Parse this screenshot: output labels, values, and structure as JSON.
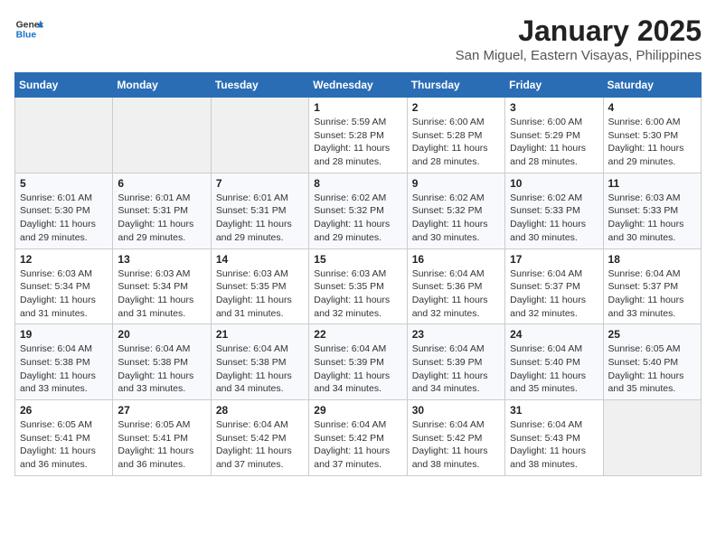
{
  "logo": {
    "line1": "General",
    "line2": "Blue"
  },
  "title": "January 2025",
  "subtitle": "San Miguel, Eastern Visayas, Philippines",
  "weekdays": [
    "Sunday",
    "Monday",
    "Tuesday",
    "Wednesday",
    "Thursday",
    "Friday",
    "Saturday"
  ],
  "weeks": [
    [
      {
        "day": "",
        "content": ""
      },
      {
        "day": "",
        "content": ""
      },
      {
        "day": "",
        "content": ""
      },
      {
        "day": "1",
        "content": "Sunrise: 5:59 AM\nSunset: 5:28 PM\nDaylight: 11 hours and 28 minutes."
      },
      {
        "day": "2",
        "content": "Sunrise: 6:00 AM\nSunset: 5:28 PM\nDaylight: 11 hours and 28 minutes."
      },
      {
        "day": "3",
        "content": "Sunrise: 6:00 AM\nSunset: 5:29 PM\nDaylight: 11 hours and 28 minutes."
      },
      {
        "day": "4",
        "content": "Sunrise: 6:00 AM\nSunset: 5:30 PM\nDaylight: 11 hours and 29 minutes."
      }
    ],
    [
      {
        "day": "5",
        "content": "Sunrise: 6:01 AM\nSunset: 5:30 PM\nDaylight: 11 hours and 29 minutes."
      },
      {
        "day": "6",
        "content": "Sunrise: 6:01 AM\nSunset: 5:31 PM\nDaylight: 11 hours and 29 minutes."
      },
      {
        "day": "7",
        "content": "Sunrise: 6:01 AM\nSunset: 5:31 PM\nDaylight: 11 hours and 29 minutes."
      },
      {
        "day": "8",
        "content": "Sunrise: 6:02 AM\nSunset: 5:32 PM\nDaylight: 11 hours and 29 minutes."
      },
      {
        "day": "9",
        "content": "Sunrise: 6:02 AM\nSunset: 5:32 PM\nDaylight: 11 hours and 30 minutes."
      },
      {
        "day": "10",
        "content": "Sunrise: 6:02 AM\nSunset: 5:33 PM\nDaylight: 11 hours and 30 minutes."
      },
      {
        "day": "11",
        "content": "Sunrise: 6:03 AM\nSunset: 5:33 PM\nDaylight: 11 hours and 30 minutes."
      }
    ],
    [
      {
        "day": "12",
        "content": "Sunrise: 6:03 AM\nSunset: 5:34 PM\nDaylight: 11 hours and 31 minutes."
      },
      {
        "day": "13",
        "content": "Sunrise: 6:03 AM\nSunset: 5:34 PM\nDaylight: 11 hours and 31 minutes."
      },
      {
        "day": "14",
        "content": "Sunrise: 6:03 AM\nSunset: 5:35 PM\nDaylight: 11 hours and 31 minutes."
      },
      {
        "day": "15",
        "content": "Sunrise: 6:03 AM\nSunset: 5:35 PM\nDaylight: 11 hours and 32 minutes."
      },
      {
        "day": "16",
        "content": "Sunrise: 6:04 AM\nSunset: 5:36 PM\nDaylight: 11 hours and 32 minutes."
      },
      {
        "day": "17",
        "content": "Sunrise: 6:04 AM\nSunset: 5:37 PM\nDaylight: 11 hours and 32 minutes."
      },
      {
        "day": "18",
        "content": "Sunrise: 6:04 AM\nSunset: 5:37 PM\nDaylight: 11 hours and 33 minutes."
      }
    ],
    [
      {
        "day": "19",
        "content": "Sunrise: 6:04 AM\nSunset: 5:38 PM\nDaylight: 11 hours and 33 minutes."
      },
      {
        "day": "20",
        "content": "Sunrise: 6:04 AM\nSunset: 5:38 PM\nDaylight: 11 hours and 33 minutes."
      },
      {
        "day": "21",
        "content": "Sunrise: 6:04 AM\nSunset: 5:38 PM\nDaylight: 11 hours and 34 minutes."
      },
      {
        "day": "22",
        "content": "Sunrise: 6:04 AM\nSunset: 5:39 PM\nDaylight: 11 hours and 34 minutes."
      },
      {
        "day": "23",
        "content": "Sunrise: 6:04 AM\nSunset: 5:39 PM\nDaylight: 11 hours and 34 minutes."
      },
      {
        "day": "24",
        "content": "Sunrise: 6:04 AM\nSunset: 5:40 PM\nDaylight: 11 hours and 35 minutes."
      },
      {
        "day": "25",
        "content": "Sunrise: 6:05 AM\nSunset: 5:40 PM\nDaylight: 11 hours and 35 minutes."
      }
    ],
    [
      {
        "day": "26",
        "content": "Sunrise: 6:05 AM\nSunset: 5:41 PM\nDaylight: 11 hours and 36 minutes."
      },
      {
        "day": "27",
        "content": "Sunrise: 6:05 AM\nSunset: 5:41 PM\nDaylight: 11 hours and 36 minutes."
      },
      {
        "day": "28",
        "content": "Sunrise: 6:04 AM\nSunset: 5:42 PM\nDaylight: 11 hours and 37 minutes."
      },
      {
        "day": "29",
        "content": "Sunrise: 6:04 AM\nSunset: 5:42 PM\nDaylight: 11 hours and 37 minutes."
      },
      {
        "day": "30",
        "content": "Sunrise: 6:04 AM\nSunset: 5:42 PM\nDaylight: 11 hours and 38 minutes."
      },
      {
        "day": "31",
        "content": "Sunrise: 6:04 AM\nSunset: 5:43 PM\nDaylight: 11 hours and 38 minutes."
      },
      {
        "day": "",
        "content": ""
      }
    ]
  ]
}
